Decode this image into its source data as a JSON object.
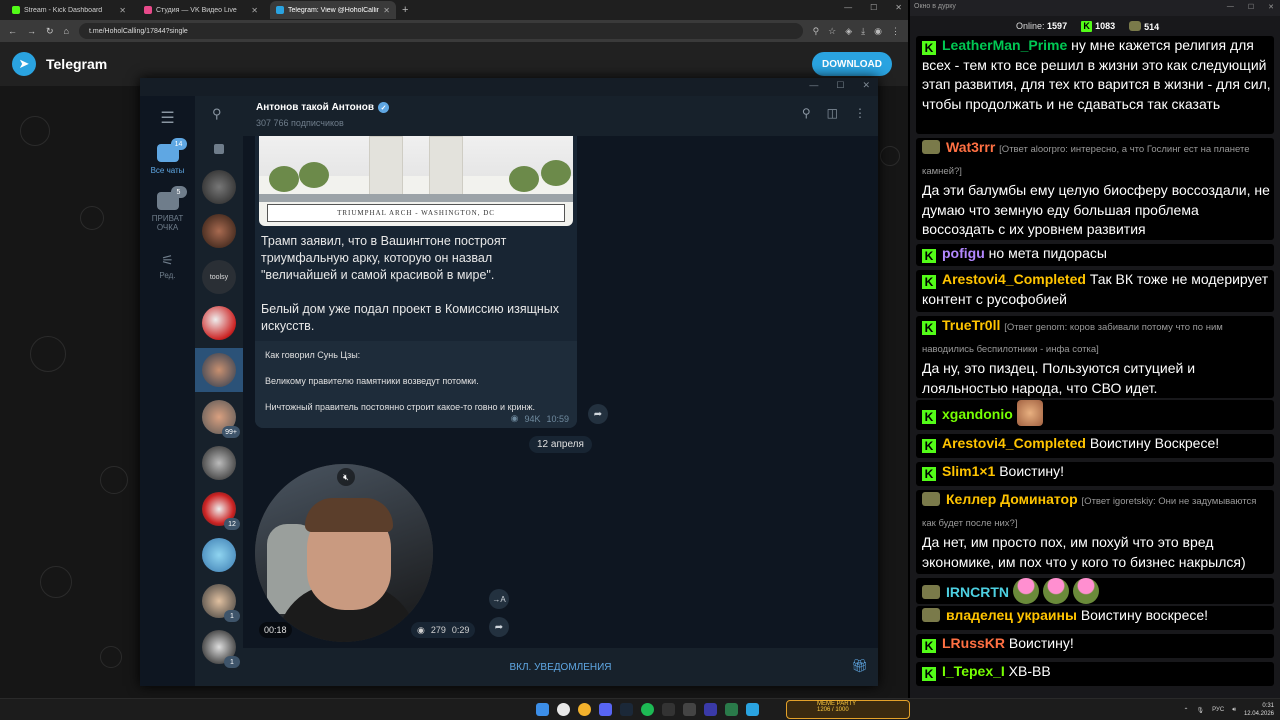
{
  "browser": {
    "tabs": [
      {
        "title": "Stream - Kick Dashboard",
        "color": "#53fc18"
      },
      {
        "title": "Студия — VK Видео Live",
        "color": "#e84a8a"
      },
      {
        "title": "Telegram: View @HoholCalling",
        "color": "#2aa3e0"
      }
    ],
    "url": "t.me/HoholCalling/17844?single"
  },
  "tgweb": {
    "brand": "Telegram",
    "download_label": "DOWNLOAD"
  },
  "app": {
    "folders": [
      {
        "label": "Все чаты",
        "badge": "14"
      },
      {
        "label": "ПРИВАТ ОЧКА",
        "badge": "5"
      },
      {
        "label": "Ред.",
        "badge": ""
      }
    ],
    "chat_badges": [
      "99+",
      "12",
      "1",
      "1"
    ],
    "channel": {
      "title": "Антонов такой Антонов",
      "subscribers": "307 766 подписчиков"
    },
    "post": {
      "image_caption": "TRIUMPHAL ARCH - WASHINGTON, DC",
      "text": "Трамп заявил, что в Вашингтоне построят триумфальную арку, которую он назвал \"величайшей и самой красивой в мире\".\n\nБелый дом уже подал проект в Комиссию изящных искусств.",
      "quote_1": "Как говорил Сунь Цзы:",
      "quote_2": "Великому правителю памятники возведут потомки.",
      "quote_3": "Ничтожный правитель постоянно строит какое-то говно и кринж.",
      "views": "94K",
      "time": "10:59"
    },
    "date_separator": "12 апреля",
    "video": {
      "duration": "00:18",
      "views": "279",
      "time": "0:29"
    },
    "notifications_label": "ВКЛ. УВЕДОМЛЕНИЯ"
  },
  "chat": {
    "window_title": "Окно в дурку",
    "online_label": "Online:",
    "online_count": "1597",
    "kick_count": "1083",
    "other_count": "514",
    "messages": [
      {
        "name": "LeatherMan_Prime",
        "color": "#00c853",
        "reply": "",
        "text": "ну мне кажется религия для всех - тем кто все решил в жизни это как следующий этап развития, для тех кто варится в жизни - для сил, чтобы продолжать и не сдаваться так сказать",
        "badge": "kick"
      },
      {
        "name": "Wat3rrr",
        "color": "#ff7043",
        "reply": "[Ответ aloorpro: интересно, а что Гослинг ест на планете камней?]",
        "text": "Да эти балумбы ему целую биосферу воссоздали, не думаю что земную еду большая проблема воссоздать с их уровнем развития",
        "badge": "sub"
      },
      {
        "name": "pofigu",
        "color": "#b388ff",
        "reply": "",
        "text": "но мета пидорасы",
        "badge": "kick"
      },
      {
        "name": "Arestovi4_Completed",
        "color": "#ffc400",
        "reply": "",
        "text": "Так ВК тоже не модерирует контент с русофобией",
        "badge": "kick"
      },
      {
        "name": "TrueTr0ll",
        "color": "#ffc400",
        "reply": "[Ответ genom: коров забивали потому что по ним наводились беспилотники - инфа сотка]",
        "text": "Да ну, это пиздец. Пользуются ситуцией и лояльностью народа, что СВО идет.",
        "badge": "kick"
      },
      {
        "name": "xgandonio",
        "color": "#76ff03",
        "reply": "",
        "text": "",
        "badge": "kick"
      },
      {
        "name": "Arestovi4_Completed",
        "color": "#ffc400",
        "reply": "",
        "text": "Воистину Воскресе!",
        "badge": "kick"
      },
      {
        "name": "Slim1×1",
        "color": "#ffc400",
        "reply": "",
        "text": "Воистину!",
        "badge": "kick"
      },
      {
        "name": "Келлер Доминатор",
        "color": "#ffc400",
        "reply": "[Ответ igoretskiy: Они не задумываются как будет после них?]",
        "text": "Да нет, им просто пох, им похуй что это вред экономике, им пох что у кого то бизнес накрылся)",
        "badge": "sub"
      },
      {
        "name": "IRNCRTN",
        "color": "#4dd0e1",
        "reply": "",
        "text": "",
        "badge": "sub"
      },
      {
        "name": "владелец украины",
        "color": "#ffc400",
        "reply": "",
        "text": "Воистину воскресе!",
        "badge": "sub"
      },
      {
        "name": "LRussKR",
        "color": "#ff7043",
        "reply": "",
        "text": "Воистину!",
        "badge": "kick"
      },
      {
        "name": "I_Tepex_I",
        "color": "#76ff03",
        "reply": "",
        "text": "ХВ-ВВ",
        "badge": "kick"
      }
    ]
  },
  "taskbar": {
    "widget_label": "MEME PARTY",
    "widget_counter": "1206 / 1000",
    "lang": "РУС",
    "time": "0:31",
    "date": "12.04.2026"
  }
}
